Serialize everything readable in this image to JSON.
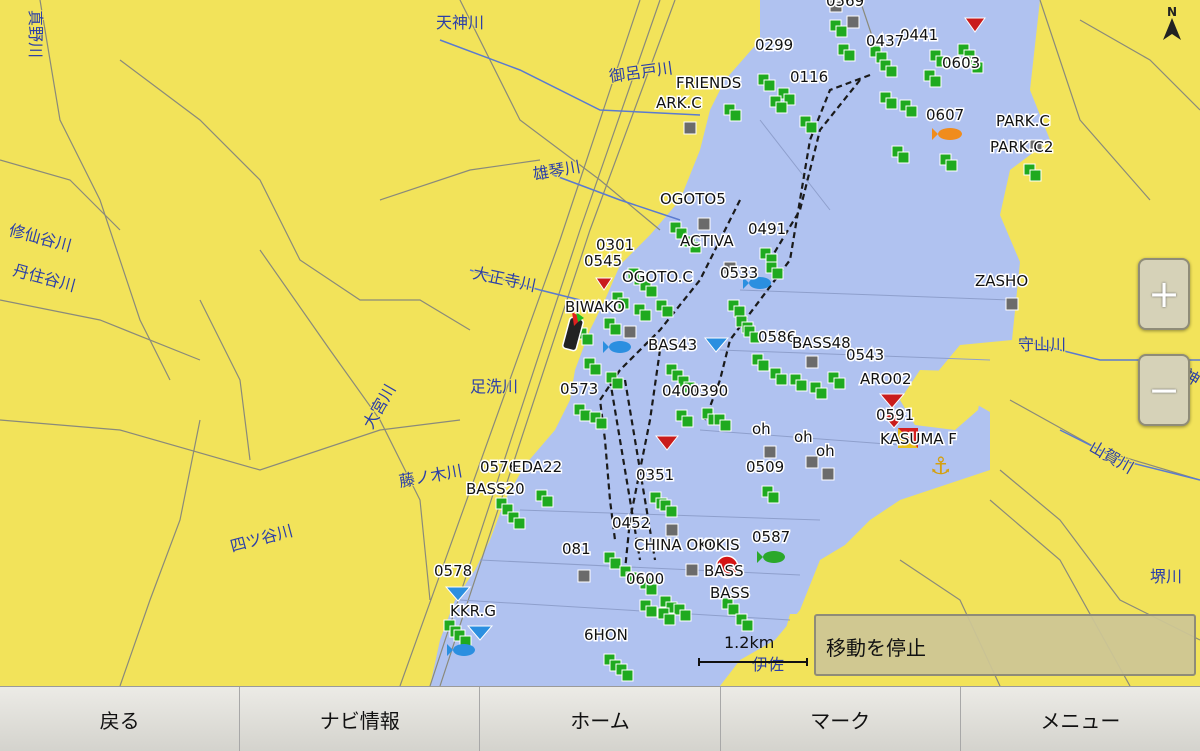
{
  "map": {
    "rivers": [
      "天神川",
      "御呂戸川",
      "雄琴川",
      "修仙谷川",
      "丹住谷川",
      "大正寺川",
      "足洗川",
      "大宮川",
      "藤ノ木川",
      "四ツ谷川",
      "守山川",
      "山賀川",
      "堺川",
      "天神",
      "真野川",
      "伊佐"
    ],
    "waypoints": [
      {
        "label": "0299"
      },
      {
        "label": "0116"
      },
      {
        "label": "FRIENDS"
      },
      {
        "label": "ARK.C"
      },
      {
        "label": "0441"
      },
      {
        "label": "0607"
      },
      {
        "label": "PARK.C"
      },
      {
        "label": "PARK.C2"
      },
      {
        "label": "OGOTO5"
      },
      {
        "label": "ACTIVA"
      },
      {
        "label": "0491"
      },
      {
        "label": "0301"
      },
      {
        "label": "0545"
      },
      {
        "label": "OGOTO.C"
      },
      {
        "label": "0533"
      },
      {
        "label": "BIWAKO"
      },
      {
        "label": "ZASHO"
      },
      {
        "label": "BAS43"
      },
      {
        "label": "0586"
      },
      {
        "label": "BASS48"
      },
      {
        "label": "0543"
      },
      {
        "label": "0573"
      },
      {
        "label": "0401"
      },
      {
        "label": "0390"
      },
      {
        "label": "ARO02"
      },
      {
        "label": "0591"
      },
      {
        "label": "KASUMA F"
      },
      {
        "label": "oh"
      },
      {
        "label": "0509"
      },
      {
        "label": "0351"
      },
      {
        "label": "0576"
      },
      {
        "label": "EDA22"
      },
      {
        "label": "BASS20"
      },
      {
        "label": "0452"
      },
      {
        "label": "081"
      },
      {
        "label": "CHINA OKI"
      },
      {
        "label": "OKIS"
      },
      {
        "label": "0587"
      },
      {
        "label": "BASS"
      },
      {
        "label": "0600"
      },
      {
        "label": "0578"
      },
      {
        "label": "KKR.G"
      },
      {
        "label": "6HON"
      },
      {
        "label": "0569"
      },
      {
        "label": "0437"
      },
      {
        "label": "0603"
      }
    ],
    "colors": {
      "land": "#f2e35a",
      "water": "#b0c2f0",
      "waypoint": "#1faa1f",
      "roads": "#8a8a7a",
      "track": "#1a1a1a"
    }
  },
  "scale": {
    "label": "1.2km"
  },
  "zoom": {
    "in_label": "+",
    "out_label": "−"
  },
  "compass": {
    "label": "N"
  },
  "status": {
    "stop_label": "移動を停止"
  },
  "nav": {
    "back": "戻る",
    "navi_info": "ナビ情報",
    "home": "ホーム",
    "mark": "マーク",
    "menu": "メニュー"
  }
}
